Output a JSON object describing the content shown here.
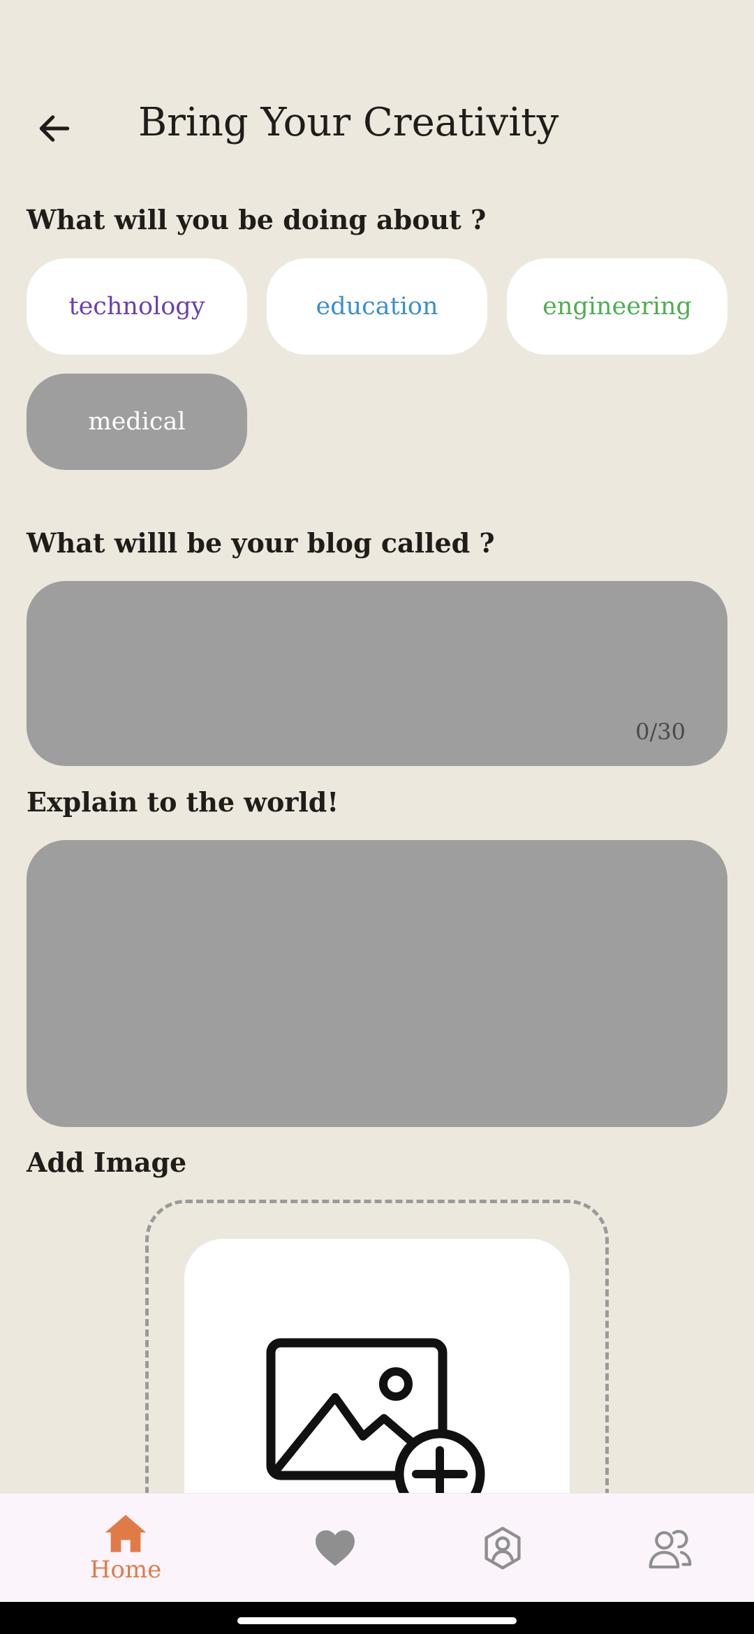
{
  "header": {
    "title": "Bring Your Creativity",
    "back_icon": "arrow-left-icon"
  },
  "topics": {
    "label": "What will you be doing about ?",
    "chips": [
      {
        "label": "technology",
        "color": "#6a3fb5",
        "selected": false
      },
      {
        "label": "education",
        "color": "#3a8fd0",
        "selected": false
      },
      {
        "label": "engineering",
        "color": "#4caf50",
        "selected": false
      },
      {
        "label": "medical",
        "color": "#ffffff",
        "selected": true
      }
    ]
  },
  "blog_name": {
    "label": "What willl be your blog called ?",
    "value": "",
    "counter": "0/30"
  },
  "description": {
    "label": "Explain to the world!",
    "value": ""
  },
  "image": {
    "label": "Add Image",
    "icon": "add-photo-icon"
  },
  "nav": {
    "items": [
      {
        "id": "home",
        "label": "Home",
        "icon": "home-icon",
        "active": true
      },
      {
        "id": "favorites",
        "label": "",
        "icon": "heart-icon",
        "active": false
      },
      {
        "id": "profile",
        "label": "",
        "icon": "profile-icon",
        "active": false
      },
      {
        "id": "community",
        "label": "",
        "icon": "people-icon",
        "active": false
      }
    ]
  },
  "colors": {
    "background": "#ede8dd",
    "accent": "#e07b46",
    "field": "#9e9e9e",
    "nav_background": "#fcf4fb"
  }
}
